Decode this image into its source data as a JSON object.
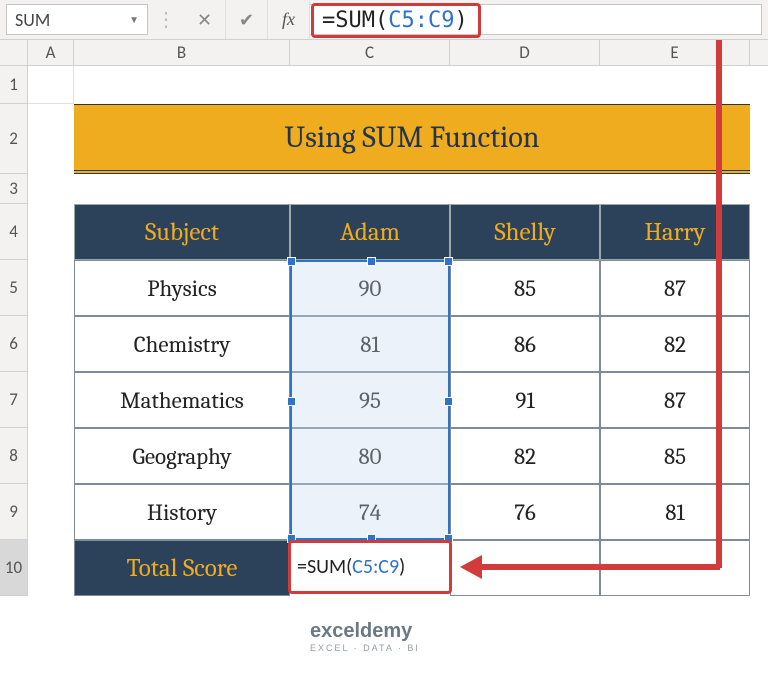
{
  "formula_bar": {
    "name_box": "SUM",
    "formula_text": "=SUM(C5:C9)",
    "formula_prefix": "=SUM(",
    "formula_ref": "C5:C9",
    "formula_suffix": ")"
  },
  "columns": [
    "A",
    "B",
    "C",
    "D",
    "E"
  ],
  "rows": [
    "1",
    "2",
    "3",
    "4",
    "5",
    "6",
    "7",
    "8",
    "9",
    "10"
  ],
  "active_row": "10",
  "title": "Using SUM Function",
  "table": {
    "headers": {
      "subject": "Subject",
      "c": "Adam",
      "d": "Shelly",
      "e": "Harry"
    },
    "rows": [
      {
        "subject": "Physics",
        "c": "90",
        "d": "85",
        "e": "87"
      },
      {
        "subject": "Chemistry",
        "c": "81",
        "d": "86",
        "e": "82"
      },
      {
        "subject": "Mathematics",
        "c": "95",
        "d": "91",
        "e": "87"
      },
      {
        "subject": "Geography",
        "c": "80",
        "d": "82",
        "e": "85"
      },
      {
        "subject": "History",
        "c": "74",
        "d": "76",
        "e": "81"
      }
    ],
    "total_label": "Total Score"
  },
  "editing_cell": {
    "prefix": "=SUM(",
    "ref": "C5:C9",
    "suffix": ")"
  },
  "chart_data": {
    "type": "table",
    "title": "Using SUM Function",
    "columns": [
      "Subject",
      "Adam",
      "Shelly",
      "Harry"
    ],
    "rows": [
      [
        "Physics",
        90,
        85,
        87
      ],
      [
        "Chemistry",
        81,
        86,
        82
      ],
      [
        "Mathematics",
        95,
        91,
        87
      ],
      [
        "Geography",
        80,
        82,
        85
      ],
      [
        "History",
        74,
        76,
        81
      ]
    ],
    "totals_row_label": "Total Score",
    "totals_formula_column_C": "=SUM(C5:C9)"
  },
  "watermark": {
    "line1": "exceldemy",
    "line2": "EXCEL · DATA · BI"
  }
}
